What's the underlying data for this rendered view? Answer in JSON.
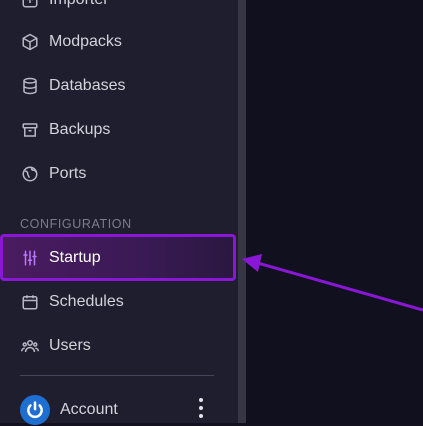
{
  "nav": {
    "importer_label": "Importer",
    "modpacks_label": "Modpacks",
    "databases_label": "Databases",
    "backups_label": "Backups",
    "ports_label": "Ports",
    "section_label": "CONFIGURATION",
    "startup_label": "Startup",
    "schedules_label": "Schedules",
    "users_label": "Users"
  },
  "account": {
    "label": "Account"
  },
  "colors": {
    "sidebar_bg": "#1f1e2e",
    "main_bg": "#11101f",
    "accent": "#8a17d6",
    "avatar": "#1f6fd1"
  },
  "icons": [
    "upload-icon",
    "cube-icon",
    "database-icon",
    "archive-icon",
    "globe-icon",
    "sliders-icon",
    "calendar-icon",
    "users-icon",
    "power-icon",
    "kebab-icon"
  ]
}
